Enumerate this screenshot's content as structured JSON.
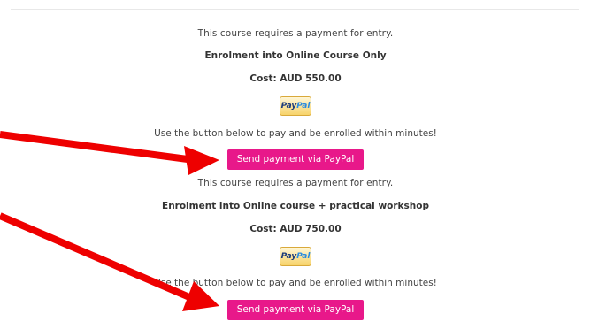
{
  "offers": [
    {
      "requirement": "This course requires a payment for entry.",
      "title": "Enrolment into Online Course Only",
      "cost": "Cost: AUD 550.00",
      "paypal_badge": "PayPal",
      "note": "Use the button below to pay and be enrolled within minutes!",
      "button_label": "Send payment via PayPal"
    },
    {
      "requirement": "This course requires a payment for entry.",
      "title": "Enrolment into Online course + practical workshop",
      "cost": "Cost: AUD 750.00",
      "paypal_badge": "PayPal",
      "note": "Use the button below to pay and be enrolled within minutes!",
      "button_label": "Send payment via PayPal"
    }
  ],
  "colors": {
    "button": "#e8188a",
    "arrow": "#ee0000"
  },
  "icons": [
    "paypal-logo-icon",
    "red-arrow-annotation"
  ]
}
